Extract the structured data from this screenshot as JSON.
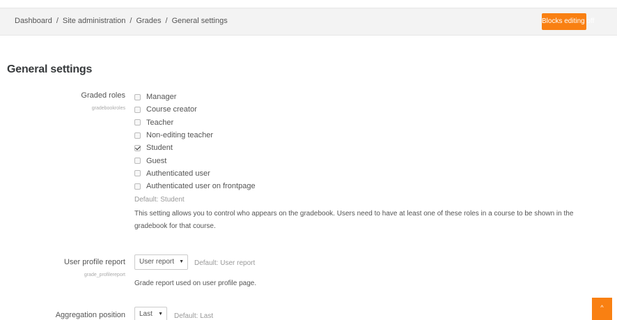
{
  "breadcrumb": {
    "items": [
      "Dashboard",
      "Site administration",
      "Grades",
      "General settings"
    ],
    "separator": "/"
  },
  "header": {
    "blocks_button": "Blocks editing off"
  },
  "page": {
    "title": "General settings"
  },
  "graded_roles": {
    "label": "Graded roles",
    "id": "gradebookroles",
    "roles": [
      {
        "label": "Manager",
        "checked": false
      },
      {
        "label": "Course creator",
        "checked": false
      },
      {
        "label": "Teacher",
        "checked": false
      },
      {
        "label": "Non-editing teacher",
        "checked": false
      },
      {
        "label": "Student",
        "checked": true
      },
      {
        "label": "Guest",
        "checked": false
      },
      {
        "label": "Authenticated user",
        "checked": false
      },
      {
        "label": "Authenticated user on frontpage",
        "checked": false
      }
    ],
    "default": "Default: Student",
    "description": "This setting allows you to control who appears on the gradebook. Users need to have at least one of these roles in a course to be shown in the gradebook for that course."
  },
  "user_profile_report": {
    "label": "User profile report",
    "id": "grade_profilereport",
    "selected": "User report",
    "default": "Default: User report",
    "description": "Grade report used on user profile page."
  },
  "aggregation_position": {
    "label": "Aggregation position",
    "selected": "Last",
    "default": "Default: Last"
  },
  "icons": {
    "caret": "▼",
    "scroll_top": "^"
  },
  "colors": {
    "accent": "#f98012",
    "navbar_bg": "#f3f3f3"
  }
}
